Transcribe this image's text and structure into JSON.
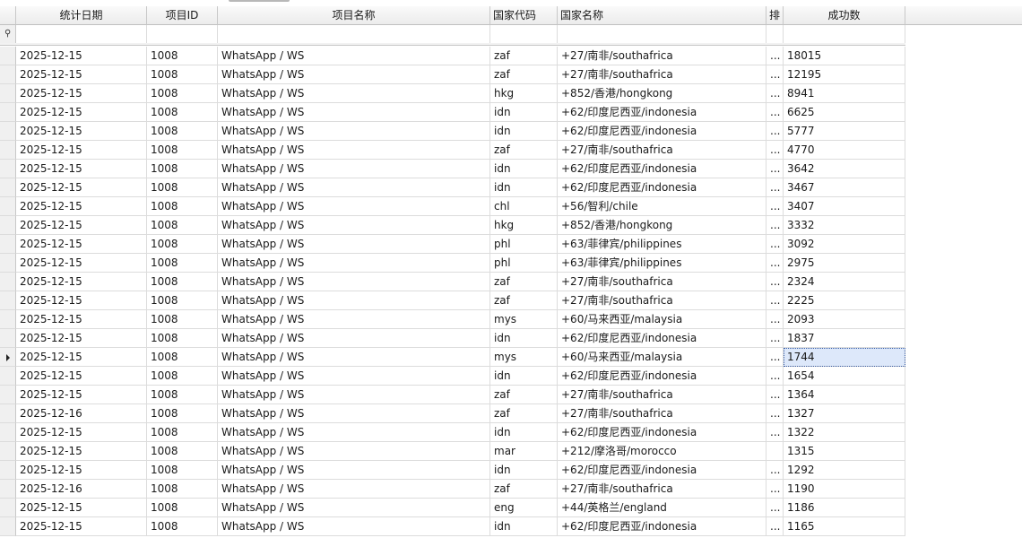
{
  "columns": [
    "统计日期",
    "项目ID",
    "项目名称",
    "国家代码",
    "国家名称",
    "排",
    "成功数"
  ],
  "rows": [
    [
      "2025-12-15",
      "1008",
      "WhatsApp / WS",
      "zaf",
      "+27/南非/southafrica",
      "...",
      "18015"
    ],
    [
      "2025-12-15",
      "1008",
      "WhatsApp / WS",
      "zaf",
      "+27/南非/southafrica",
      "...",
      "12195"
    ],
    [
      "2025-12-15",
      "1008",
      "WhatsApp / WS",
      "hkg",
      "+852/香港/hongkong",
      "...",
      "8941"
    ],
    [
      "2025-12-15",
      "1008",
      "WhatsApp / WS",
      "idn",
      "+62/印度尼西亚/indonesia",
      "...",
      "6625"
    ],
    [
      "2025-12-15",
      "1008",
      "WhatsApp / WS",
      "idn",
      "+62/印度尼西亚/indonesia",
      "...",
      "5777"
    ],
    [
      "2025-12-15",
      "1008",
      "WhatsApp / WS",
      "zaf",
      "+27/南非/southafrica",
      "...",
      "4770"
    ],
    [
      "2025-12-15",
      "1008",
      "WhatsApp / WS",
      "idn",
      "+62/印度尼西亚/indonesia",
      "...",
      "3642"
    ],
    [
      "2025-12-15",
      "1008",
      "WhatsApp / WS",
      "idn",
      "+62/印度尼西亚/indonesia",
      "...",
      "3467"
    ],
    [
      "2025-12-15",
      "1008",
      "WhatsApp / WS",
      "chl",
      "+56/智利/chile",
      "...",
      "3407"
    ],
    [
      "2025-12-15",
      "1008",
      "WhatsApp / WS",
      "hkg",
      "+852/香港/hongkong",
      "...",
      "3332"
    ],
    [
      "2025-12-15",
      "1008",
      "WhatsApp / WS",
      "phl",
      "+63/菲律宾/philippines",
      "...",
      "3092"
    ],
    [
      "2025-12-15",
      "1008",
      "WhatsApp / WS",
      "phl",
      "+63/菲律宾/philippines",
      "...",
      "2975"
    ],
    [
      "2025-12-15",
      "1008",
      "WhatsApp / WS",
      "zaf",
      "+27/南非/southafrica",
      "...",
      "2324"
    ],
    [
      "2025-12-15",
      "1008",
      "WhatsApp / WS",
      "zaf",
      "+27/南非/southafrica",
      "...",
      "2225"
    ],
    [
      "2025-12-15",
      "1008",
      "WhatsApp / WS",
      "mys",
      "+60/马来西亚/malaysia",
      "...",
      "2093"
    ],
    [
      "2025-12-15",
      "1008",
      "WhatsApp / WS",
      "idn",
      "+62/印度尼西亚/indonesia",
      "...",
      "1837"
    ],
    [
      "2025-12-15",
      "1008",
      "WhatsApp / WS",
      "mys",
      "+60/马来西亚/malaysia",
      "...",
      "1744"
    ],
    [
      "2025-12-15",
      "1008",
      "WhatsApp / WS",
      "idn",
      "+62/印度尼西亚/indonesia",
      "...",
      "1654"
    ],
    [
      "2025-12-15",
      "1008",
      "WhatsApp / WS",
      "zaf",
      "+27/南非/southafrica",
      "...",
      "1364"
    ],
    [
      "2025-12-16",
      "1008",
      "WhatsApp / WS",
      "zaf",
      "+27/南非/southafrica",
      "...",
      "1327"
    ],
    [
      "2025-12-15",
      "1008",
      "WhatsApp / WS",
      "idn",
      "+62/印度尼西亚/indonesia",
      "...",
      "1322"
    ],
    [
      "2025-12-15",
      "1008",
      "WhatsApp / WS",
      "mar",
      "+212/摩洛哥/morocco",
      "",
      "1315"
    ],
    [
      "2025-12-15",
      "1008",
      "WhatsApp / WS",
      "idn",
      "+62/印度尼西亚/indonesia",
      "...",
      "1292"
    ],
    [
      "2025-12-16",
      "1008",
      "WhatsApp / WS",
      "zaf",
      "+27/南非/southafrica",
      "...",
      "1190"
    ],
    [
      "2025-12-15",
      "1008",
      "WhatsApp / WS",
      "eng",
      "+44/英格兰/england",
      "...",
      "1186"
    ],
    [
      "2025-12-15",
      "1008",
      "WhatsApp / WS",
      "idn",
      "+62/印度尼西亚/indonesia",
      "...",
      "1165"
    ]
  ],
  "current_row": 16,
  "focused_column": 6,
  "icons": {
    "filter": "filter-pin-icon",
    "current_row": "row-pointer-icon"
  },
  "colors": {
    "focused_cell": "#dde8fa",
    "grid_line": "#dcdcdc",
    "header_bg": "#ececec"
  }
}
